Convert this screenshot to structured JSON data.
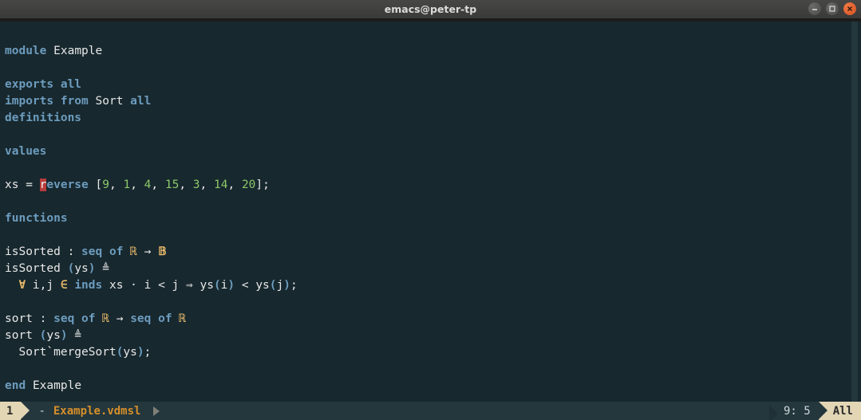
{
  "titlebar": {
    "title": "emacs@peter-tp"
  },
  "code": {
    "l1": {
      "kw": "module",
      "sp": " ",
      "name": "Example"
    },
    "l3": {
      "kw1": "exports",
      "sp": " ",
      "kw2": "all"
    },
    "l4": {
      "kw1": "imports",
      "sp1": " ",
      "kw2": "from",
      "sp2": " ",
      "name": "Sort",
      "sp3": " ",
      "kw3": "all"
    },
    "l5": {
      "kw": "definitions"
    },
    "l7": {
      "kw": "values"
    },
    "l9": {
      "pre": "xs = ",
      "cur": "r",
      "kw": "everse",
      "sp": " [",
      "n1": "9",
      "c1": ", ",
      "n2": "1",
      "c2": ", ",
      "n3": "4",
      "c3": ", ",
      "n4": "15",
      "c4": ", ",
      "n5": "3",
      "c5": ", ",
      "n6": "14",
      "c6": ", ",
      "n7": "20",
      "end": "];"
    },
    "l11": {
      "kw": "functions"
    },
    "l13": {
      "pre": "isSorted : ",
      "kw1": "seq",
      "sp1": " ",
      "kw2": "of",
      "sp2": " ",
      "sym1": "ℝ",
      "arr": " → ",
      "sym2": "𝔹"
    },
    "l14": {
      "pre": "isSorted ",
      "p1": "(",
      "arg": "ys",
      "p2": ")",
      "eq": " ≜"
    },
    "l15": {
      "pre": "  ",
      "sym1": "∀",
      "mid1": " i,j ",
      "sym2": "∈",
      "sp1": " ",
      "kw": "inds",
      "mid2": " xs · i < j ⇒ ys",
      "p1": "(",
      "a1": "i",
      "p2": ")",
      "mid3": " < ys",
      "p3": "(",
      "a2": "j",
      "p4": ")",
      "end": ";"
    },
    "l17": {
      "pre": "sort : ",
      "kw1": "seq",
      "sp1": " ",
      "kw2": "of",
      "sp2": " ",
      "sym1": "ℝ",
      "arr": " → ",
      "kw3": "seq",
      "sp3": " ",
      "kw4": "of",
      "sp4": " ",
      "sym2": "ℝ"
    },
    "l18": {
      "pre": "sort ",
      "p1": "(",
      "arg": "ys",
      "p2": ")",
      "eq": " ≜"
    },
    "l19": {
      "pre": "  Sort`mergeSort",
      "p1": "(",
      "arg": "ys",
      "p2": ")",
      "end": ";"
    },
    "l21": {
      "kw": "end",
      "sp": " ",
      "name": "Example"
    }
  },
  "modeline": {
    "indicator": "1",
    "modified": "-",
    "filename": "Example.vdmsl",
    "position": "9: 5",
    "percent": "All"
  }
}
